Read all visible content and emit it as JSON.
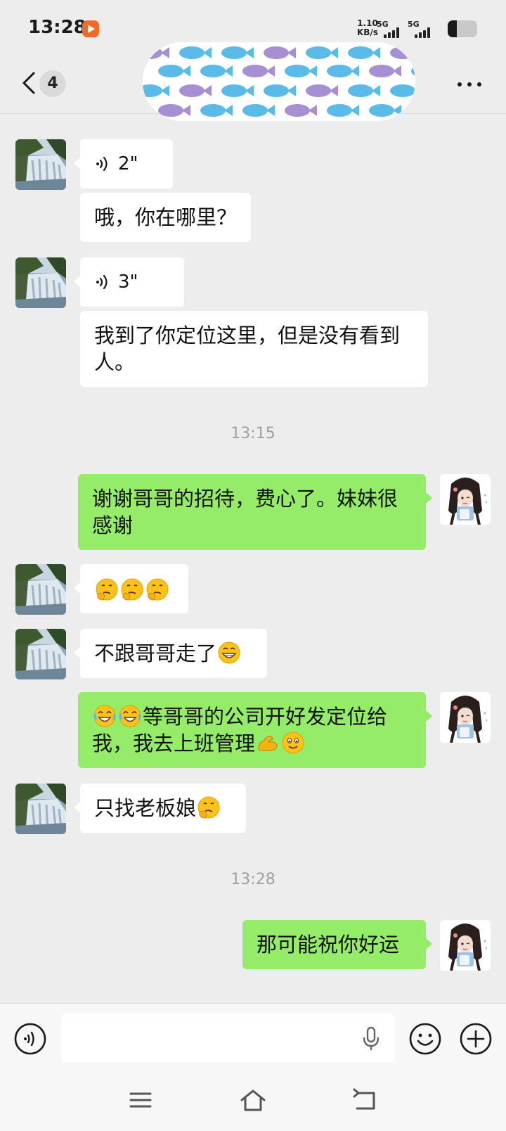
{
  "status_bar": {
    "time": "13:28",
    "net_speed_value": "1.10",
    "net_speed_unit": "KB/s",
    "signal1_label": "5G",
    "signal2_label": "5G",
    "battery_level": 0.3
  },
  "header": {
    "unread_count": "4"
  },
  "messages": [
    {
      "side": "left",
      "type": "voice",
      "duration": "2\""
    },
    {
      "side": "left",
      "type": "text",
      "text": "哦，你在哪里？"
    },
    {
      "side": "left",
      "type": "voice",
      "duration": "3\""
    },
    {
      "side": "left",
      "type": "text",
      "text_line1": "我到了你定位这里，但是没有看到",
      "text_line2": "人。"
    },
    {
      "type": "time",
      "text": "13:15"
    },
    {
      "side": "right",
      "type": "text",
      "text_line1": "谢谢哥哥的招待，费心了。妹妹很",
      "text_line2": "感谢"
    },
    {
      "side": "left",
      "type": "emoji",
      "emoji": [
        "thinking-face",
        "thinking-face",
        "thinking-face"
      ]
    },
    {
      "side": "left",
      "type": "text",
      "text": "不跟哥哥走了",
      "trailing_emoji": "grinning-face"
    },
    {
      "side": "right",
      "type": "text",
      "line1_text": "等哥哥的公司开好发定位给",
      "line2_text": "我，我去上班管理",
      "emoji_before": [
        "tears-of-joy",
        "tears-of-joy"
      ],
      "emoji_after": [
        "flexed-arm",
        "slight-smile"
      ]
    },
    {
      "side": "left",
      "type": "text",
      "text": "只找老板娘",
      "trailing_emoji": "thinking-face"
    },
    {
      "type": "time",
      "text": "13:28"
    },
    {
      "side": "right",
      "type": "text",
      "text": "那可能祝你好运"
    }
  ],
  "input_bar": {
    "placeholder": ""
  },
  "colors": {
    "background": "#ededed",
    "bubble_left": "#ffffff",
    "bubble_right": "#95ec69",
    "timestamp": "#a0a0a0"
  },
  "icons": [
    "voice-icon",
    "microphone-icon",
    "emoji-icon",
    "plus-icon",
    "menu-icon",
    "home-icon",
    "back-icon",
    "more-icon",
    "chevron-left-icon"
  ]
}
